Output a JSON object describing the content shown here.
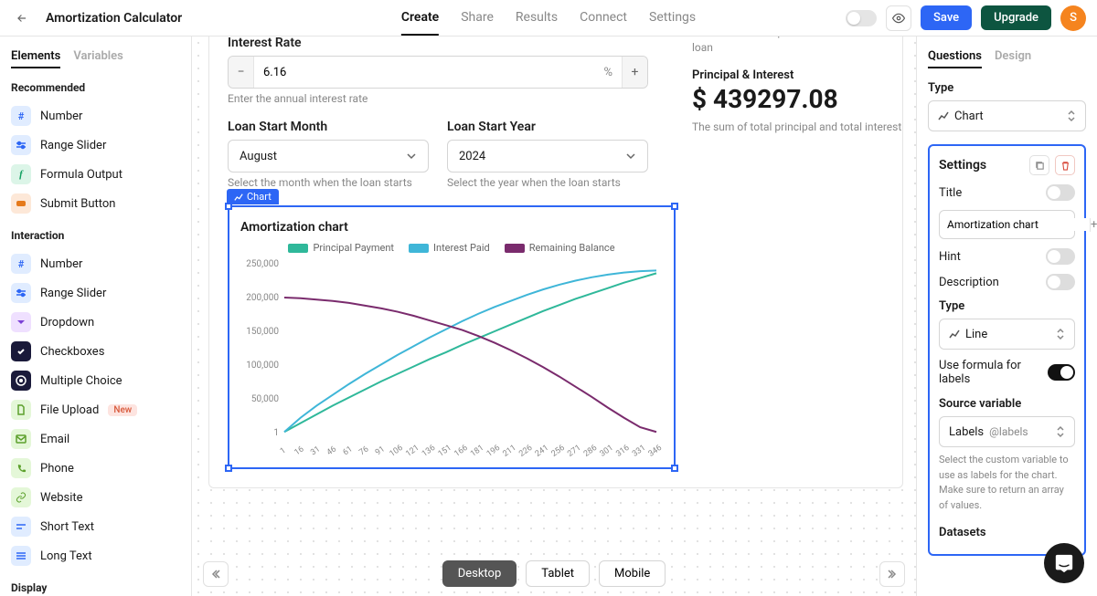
{
  "header": {
    "title": "Amortization Calculator",
    "tabs": [
      "Create",
      "Share",
      "Results",
      "Connect",
      "Settings"
    ],
    "active_tab": 0,
    "save": "Save",
    "upgrade": "Upgrade",
    "avatar_initial": "S"
  },
  "left_sidebar": {
    "tabs": [
      "Elements",
      "Variables"
    ],
    "active_tab": 0,
    "sections": {
      "recommended": {
        "heading": "Recommended",
        "items": [
          "Number",
          "Range Slider",
          "Formula Output",
          "Submit Button"
        ]
      },
      "interaction": {
        "heading": "Interaction",
        "items": [
          "Number",
          "Range Slider",
          "Dropdown",
          "Checkboxes",
          "Multiple Choice",
          "File Upload",
          "Email",
          "Phone",
          "Website",
          "Short Text",
          "Long Text"
        ],
        "new_badge": "New"
      },
      "display": {
        "heading": "Display"
      }
    }
  },
  "canvas": {
    "interest_rate": {
      "label": "Interest Rate",
      "value": "6.16",
      "suffix": "%",
      "hint": "Enter the annual interest rate"
    },
    "loan_start_month": {
      "label": "Loan Start Month",
      "value": "August",
      "hint": "Select the month when the loan starts"
    },
    "loan_start_year": {
      "label": "Loan Start Year",
      "value": "2024",
      "hint": "Select the year when the loan starts"
    },
    "chart_tag": "Chart",
    "chart_title": "Amortization chart",
    "stats": {
      "hint_top": "The total interest paid over the life of the loan",
      "pi_label": "Principal & Interest",
      "pi_value": "$ 439297.08",
      "pi_hint": "The sum of total principal and total interest"
    },
    "devices": [
      "Desktop",
      "Tablet",
      "Mobile"
    ],
    "active_device": 0
  },
  "right_sidebar": {
    "tabs": [
      "Questions",
      "Design"
    ],
    "active_tab": 0,
    "type_label": "Type",
    "type_value": "Chart",
    "settings": {
      "heading": "Settings",
      "title_label": "Title",
      "title_value": "Amortization chart",
      "hint_label": "Hint",
      "description_label": "Description",
      "type2_label": "Type",
      "type2_value": "Line",
      "formula_labels": "Use formula for labels",
      "source_var_label": "Source variable",
      "source_var_name": "Labels",
      "source_var_ref": "@labels",
      "source_var_hint": "Select the custom variable to use as labels for the chart. Make sure to return an array of values.",
      "datasets_label": "Datasets"
    }
  },
  "chart_data": {
    "type": "line",
    "title": "Amortization chart",
    "xlabel": "",
    "ylabel": "",
    "ylim": [
      1,
      250000
    ],
    "categories": [
      1,
      16,
      31,
      46,
      61,
      76,
      91,
      106,
      121,
      136,
      151,
      166,
      181,
      196,
      211,
      226,
      241,
      256,
      271,
      286,
      301,
      316,
      331,
      346
    ],
    "series": [
      {
        "name": "Principal Payment",
        "color": "#2fb89a",
        "values": [
          1000,
          14000,
          27000,
          40000,
          52000,
          64000,
          76000,
          87000,
          98000,
          109000,
          119000,
          130000,
          140000,
          150000,
          160000,
          170000,
          180000,
          189000,
          198000,
          206000,
          214000,
          222000,
          229000,
          236000
        ]
      },
      {
        "name": "Interest Paid",
        "color": "#3fb6d8",
        "values": [
          1000,
          22000,
          40000,
          56000,
          72000,
          87000,
          101000,
          115000,
          128000,
          141000,
          153000,
          165000,
          176000,
          186000,
          195000,
          204000,
          212000,
          219000,
          225000,
          230000,
          234000,
          237000,
          239000,
          240000
        ]
      },
      {
        "name": "Remaining Balance",
        "color": "#7a2b6d",
        "values": [
          200000,
          199000,
          197000,
          195000,
          192000,
          188000,
          184000,
          179000,
          173000,
          166000,
          159000,
          152000,
          143000,
          133000,
          122000,
          110000,
          97000,
          83000,
          68000,
          53000,
          37000,
          22000,
          8000,
          1000
        ]
      }
    ],
    "y_ticks": [
      1,
      50000,
      100000,
      150000,
      200000,
      250000
    ]
  }
}
